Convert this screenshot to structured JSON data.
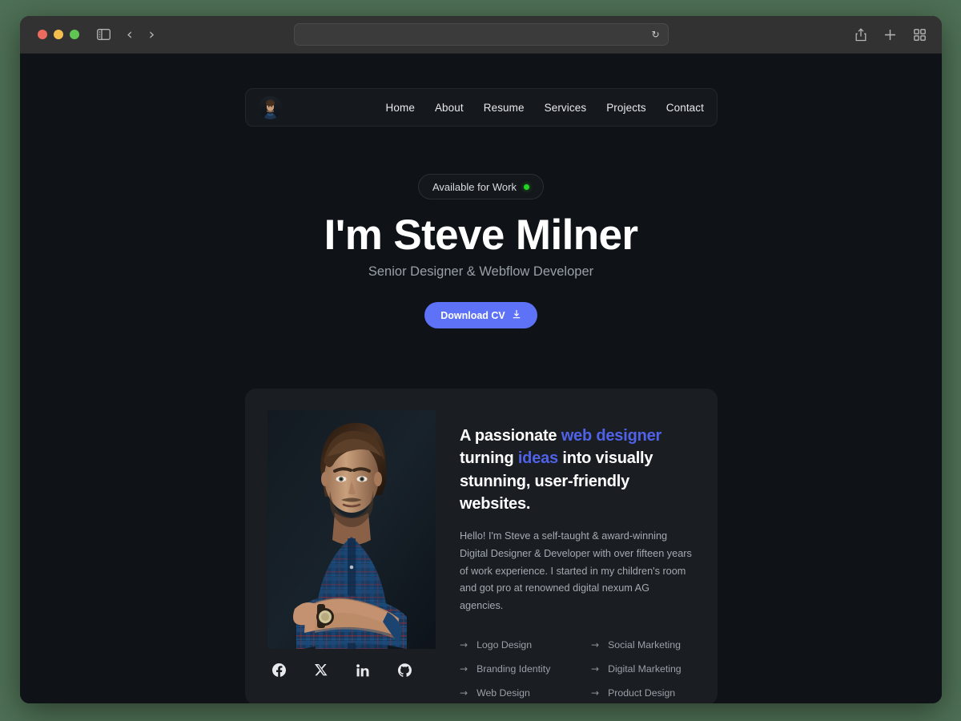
{
  "browser": {
    "traffic_lights": [
      "close",
      "minimize",
      "maximize"
    ],
    "sidebar_icon": "sidebar-icon",
    "back_label": "‹",
    "forward_label": "›",
    "url_value": "",
    "url_placeholder": "",
    "reload_icon": "reload-icon",
    "share_icon": "share-icon",
    "new_tab_icon": "plus-icon",
    "tab_overview_icon": "tab-grid-icon"
  },
  "nav": {
    "avatar_alt": "Steve Milner avatar",
    "links": [
      {
        "label": "Home"
      },
      {
        "label": "About"
      },
      {
        "label": "Resume"
      },
      {
        "label": "Services"
      },
      {
        "label": "Projects"
      },
      {
        "label": "Contact"
      }
    ]
  },
  "hero": {
    "badge_label": "Available for Work",
    "status_color": "#24d423",
    "title": "I'm Steve Milner",
    "subtitle": "Senior Designer & Webflow Developer",
    "cta_label": "Download CV",
    "cta_icon": "download-icon",
    "cta_color": "#5d72f6"
  },
  "about": {
    "photo_alt": "Portrait of Steve Milner with crossed arms in a blue plaid shirt",
    "heading": {
      "part1": "A passionate ",
      "highlight1": "web designer",
      "part2": " turning ",
      "highlight2": "ideas",
      "part3": " into visually stunning, user-friendly websites."
    },
    "highlight_color": "#4f62e8",
    "body": "Hello! I'm Steve a self-taught & award-winning Digital Designer & Developer with over fifteen years of work experience. I started in my children's room and got pro at renowned digital nexum AG agencies.",
    "services_left": [
      {
        "label": "Logo Design"
      },
      {
        "label": "Branding Identity"
      },
      {
        "label": "Web Design"
      }
    ],
    "services_right": [
      {
        "label": "Social Marketing"
      },
      {
        "label": "Digital Marketing"
      },
      {
        "label": "Product Design"
      }
    ],
    "arrow_glyph": "→",
    "socials": [
      {
        "name": "facebook"
      },
      {
        "name": "x-twitter"
      },
      {
        "name": "linkedin"
      },
      {
        "name": "github"
      }
    ]
  },
  "theme": {
    "page_bg": "#0f1216",
    "card_bg": "#1a1d21",
    "desktop_bg": "#4e7055"
  }
}
